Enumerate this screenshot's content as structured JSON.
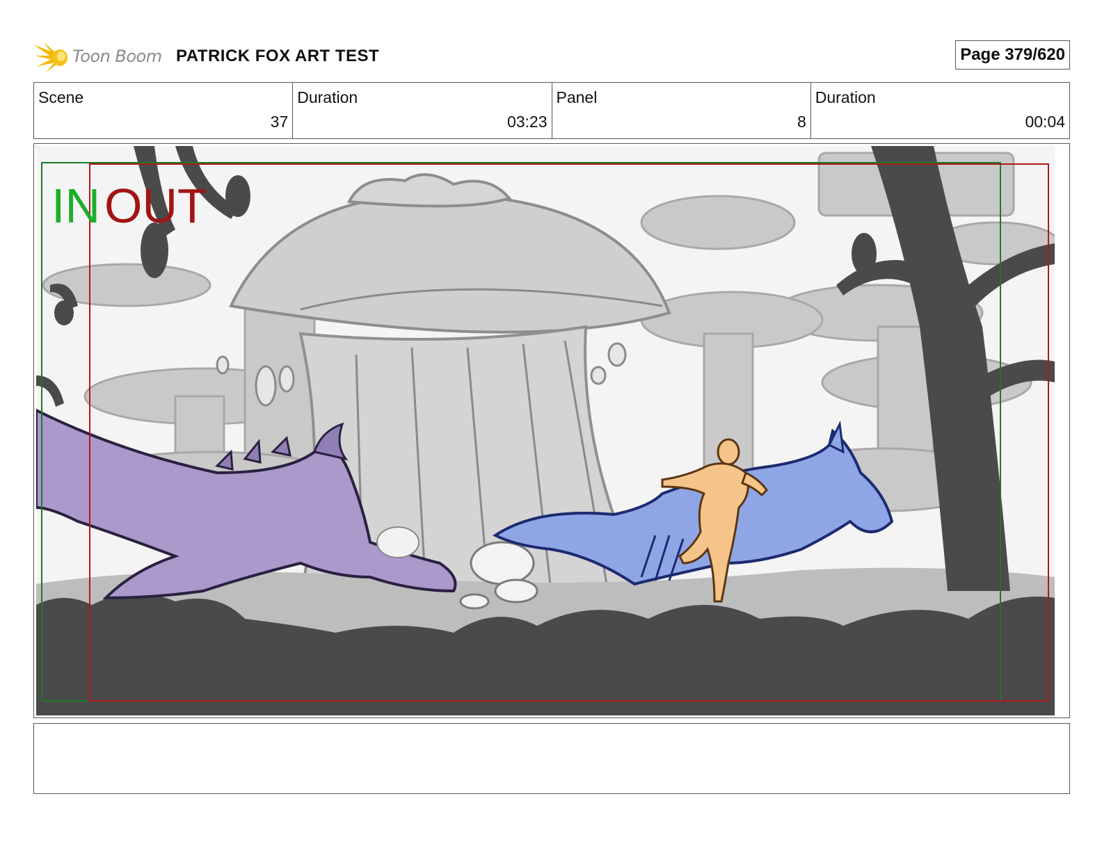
{
  "header": {
    "logo_text": "Toon Boom",
    "project_title": "PATRICK FOX ART TEST",
    "page_label": "Page 379/620"
  },
  "info": {
    "scene_label": "Scene",
    "scene_value": "37",
    "scene_duration_label": "Duration",
    "scene_duration_value": "03:23",
    "panel_label": "Panel",
    "panel_value": "8",
    "panel_duration_label": "Duration",
    "panel_duration_value": "00:04"
  },
  "panel": {
    "in_label": "IN",
    "out_label": "OUT",
    "in_color": "#1fae2a",
    "out_color": "#a11414"
  },
  "notes": {
    "text": ""
  }
}
